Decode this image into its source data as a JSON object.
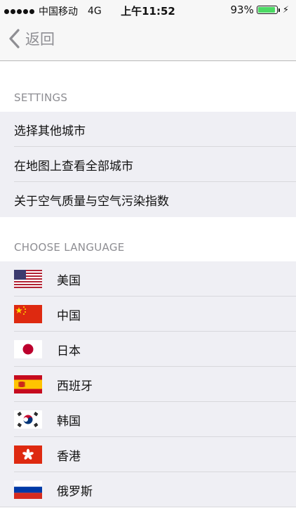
{
  "status_bar": {
    "carrier": "中国移动",
    "network": "4G",
    "time": "上午11:52",
    "battery_percent": "93%",
    "battery_level": 0.93
  },
  "nav": {
    "back_label": "返回"
  },
  "settings": {
    "header": "SETTINGS",
    "items": [
      "选择其他城市",
      "在地图上查看全部城市",
      "关于空气质量与空气污染指数"
    ]
  },
  "language": {
    "header": "CHOOSE LANGUAGE",
    "items": [
      {
        "label": "美国",
        "flag": "us-flag-icon"
      },
      {
        "label": "中国",
        "flag": "china-flag-icon"
      },
      {
        "label": "日本",
        "flag": "japan-flag-icon"
      },
      {
        "label": "西班牙",
        "flag": "spain-flag-icon"
      },
      {
        "label": "韩国",
        "flag": "korea-flag-icon"
      },
      {
        "label": "香港",
        "flag": "hong-kong-flag-icon"
      },
      {
        "label": "俄罗斯",
        "flag": "russia-flag-icon"
      }
    ]
  },
  "colors": {
    "battery_green": "#4cd964",
    "list_bg": "#efeff4",
    "header_gray": "#8e8e93"
  }
}
